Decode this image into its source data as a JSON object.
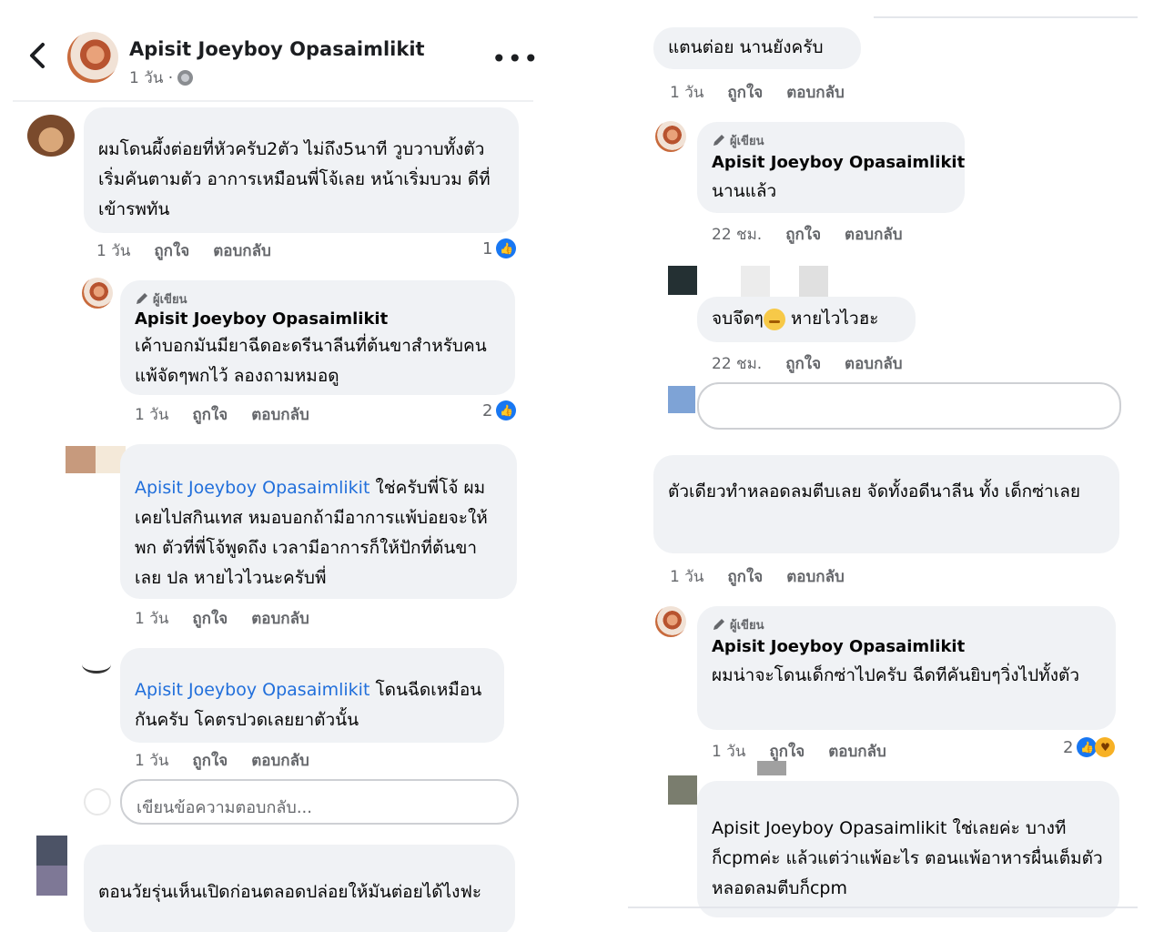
{
  "header": {
    "name": "Apisit Joeyboy Opasaimlikit",
    "time": "1 วัน ·",
    "more_icon": "more-icon"
  },
  "left": {
    "c1": {
      "text": "ผมโดนผึ้งต่อยที่หัวครับ2ตัว ไม่ถึง5นาที วูบวาบทั้งตัว เริ่มคันตามตัว อาการเหมือนพี่โจ้เลย หน้าเริ่มบวม ดีที่เข้ารพทัน",
      "time": "1 วัน",
      "like": "ถูกใจ",
      "reply": "ตอบกลับ",
      "count": "1"
    },
    "c2": {
      "author_badge": "ผู้เขียน",
      "name": "Apisit Joeyboy Opasaimlikit",
      "text": "เค้าบอกมันมียาฉีดอะดรีนาลีนที่ต้นขาสำหรับคนแพ้จัดๆพกไว้ ลองถามหมอดู",
      "time": "1 วัน",
      "like": "ถูกใจ",
      "reply": "ตอบกลับ",
      "count": "2"
    },
    "c3": {
      "mention": "Apisit Joeyboy Opasaimlikit",
      "text": " ใช่ครับพี่โจ้ ผมเคยไปสกินเทส หมอบอกถ้ามีอาการแพ้บ่อยจะให้พก ตัวที่พี่โจ้พูดถึง เวลามีอาการก็ให้ปักที่ต้นขาเลย ปล หายไวไวนะครับพี่",
      "time": "1 วัน",
      "like": "ถูกใจ",
      "reply": "ตอบกลับ"
    },
    "c4": {
      "mention": "Apisit Joeyboy Opasaimlikit",
      "text": " โดนฉีดเหมือนกันครับ  โคตรปวดเลยยาตัวนั้น",
      "time": "1 วัน",
      "like": "ถูกใจ",
      "reply": "ตอบกลับ"
    },
    "reply_placeholder": "เขียนข้อความตอบกลับ...",
    "c5": {
      "text": "ตอนวัยรุ่นเห็นเปิดก่อนตลอดปล่อยให้มันต่อยได้ไงฟะ"
    }
  },
  "right": {
    "r1": {
      "text": "แตนต่อย นานยังครับ",
      "time": "1 วัน",
      "like": "ถูกใจ",
      "reply": "ตอบกลับ"
    },
    "r2": {
      "author_badge": "ผู้เขียน",
      "name": "Apisit Joeyboy Opasaimlikit",
      "text": "นานแล้ว",
      "time": "22 ชม.",
      "like": "ถูกใจ",
      "reply": "ตอบกลับ"
    },
    "r3": {
      "text_a": "จบจึดๆ",
      "text_b": " หายไวไวฮะ",
      "time": "22 ชม.",
      "like": "ถูกใจ",
      "reply": "ตอบกลับ"
    },
    "r4": {
      "text": "ตัวเดียวทำหลอดลมตีบเลย จัดทั้งอดีนาลีน ทั้ง เด็กซ่าเลย",
      "time": "1 วัน",
      "like": "ถูกใจ",
      "reply": "ตอบกลับ"
    },
    "r5": {
      "author_badge": "ผู้เขียน",
      "name": "Apisit Joeyboy Opasaimlikit",
      "text": "ผมน่าจะโดนเด็กซ่าไปครับ ฉีดทีคันยิบๆวิ่งไปทั้งตัว",
      "time": "1 วัน",
      "like": "ถูกใจ",
      "reply": "ตอบกลับ",
      "count": "2"
    },
    "r6": {
      "text": "Apisit Joeyboy Opasaimlikit ใช่เลยค่ะ บางทีก็cpmค่ะ แล้วแต่ว่าแพ้อะไร ตอนแพ้อาหารผื่นเต็มตัว หลอดลมตีบก็cpm"
    }
  }
}
